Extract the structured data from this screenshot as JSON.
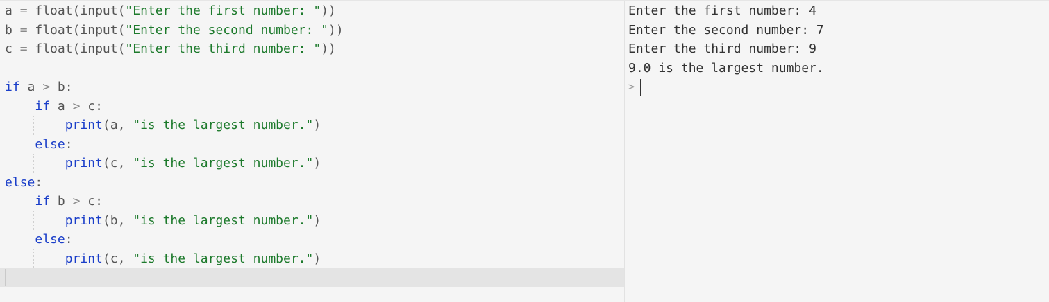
{
  "editor": {
    "lines": [
      [
        {
          "t": "a ",
          "c": "plain"
        },
        {
          "t": "=",
          "c": "op"
        },
        {
          "t": " float(input(",
          "c": "plain"
        },
        {
          "t": "\"Enter the first number: \"",
          "c": "str"
        },
        {
          "t": "))",
          "c": "plain"
        }
      ],
      [
        {
          "t": "b ",
          "c": "plain"
        },
        {
          "t": "=",
          "c": "op"
        },
        {
          "t": " float(input(",
          "c": "plain"
        },
        {
          "t": "\"Enter the second number: \"",
          "c": "str"
        },
        {
          "t": "))",
          "c": "plain"
        }
      ],
      [
        {
          "t": "c ",
          "c": "plain"
        },
        {
          "t": "=",
          "c": "op"
        },
        {
          "t": " float(input(",
          "c": "plain"
        },
        {
          "t": "\"Enter the third number: \"",
          "c": "str"
        },
        {
          "t": "))",
          "c": "plain"
        }
      ],
      [],
      [
        {
          "t": "if",
          "c": "kw"
        },
        {
          "t": " a ",
          "c": "plain"
        },
        {
          "t": ">",
          "c": "op"
        },
        {
          "t": " b:",
          "c": "plain"
        }
      ],
      [
        {
          "t": "    ",
          "c": "plain"
        },
        {
          "t": "if",
          "c": "kw"
        },
        {
          "t": " a ",
          "c": "plain"
        },
        {
          "t": ">",
          "c": "op"
        },
        {
          "t": " c:",
          "c": "plain"
        }
      ],
      [
        {
          "t": "        ",
          "c": "plain"
        },
        {
          "t": "print",
          "c": "fn"
        },
        {
          "t": "(a, ",
          "c": "plain"
        },
        {
          "t": "\"is the largest number.\"",
          "c": "str"
        },
        {
          "t": ")",
          "c": "plain"
        }
      ],
      [
        {
          "t": "    ",
          "c": "plain"
        },
        {
          "t": "else",
          "c": "kw"
        },
        {
          "t": ":",
          "c": "plain"
        }
      ],
      [
        {
          "t": "        ",
          "c": "plain"
        },
        {
          "t": "print",
          "c": "fn"
        },
        {
          "t": "(c, ",
          "c": "plain"
        },
        {
          "t": "\"is the largest number.\"",
          "c": "str"
        },
        {
          "t": ")",
          "c": "plain"
        }
      ],
      [
        {
          "t": "else",
          "c": "kw"
        },
        {
          "t": ":",
          "c": "plain"
        }
      ],
      [
        {
          "t": "    ",
          "c": "plain"
        },
        {
          "t": "if",
          "c": "kw"
        },
        {
          "t": " b ",
          "c": "plain"
        },
        {
          "t": ">",
          "c": "op"
        },
        {
          "t": " c:",
          "c": "plain"
        }
      ],
      [
        {
          "t": "        ",
          "c": "plain"
        },
        {
          "t": "print",
          "c": "fn"
        },
        {
          "t": "(b, ",
          "c": "plain"
        },
        {
          "t": "\"is the largest number.\"",
          "c": "str"
        },
        {
          "t": ")",
          "c": "plain"
        }
      ],
      [
        {
          "t": "    ",
          "c": "plain"
        },
        {
          "t": "else",
          "c": "kw"
        },
        {
          "t": ":",
          "c": "plain"
        }
      ],
      [
        {
          "t": "        ",
          "c": "plain"
        },
        {
          "t": "print",
          "c": "fn"
        },
        {
          "t": "(c, ",
          "c": "plain"
        },
        {
          "t": "\"is the largest number.\"",
          "c": "str"
        },
        {
          "t": ")",
          "c": "plain"
        }
      ]
    ],
    "indent_guide_lines": [
      6,
      8,
      11,
      13
    ]
  },
  "console": {
    "lines": [
      "Enter the first number: 4",
      "Enter the second number: 7",
      "Enter the third number: 9",
      "9.0 is the largest number."
    ],
    "prompt": ">"
  },
  "colors": {
    "keyword": "#1a3ec9",
    "string": "#1d7a2c",
    "operator": "#8a8a8a",
    "text": "#555555",
    "background": "#f5f5f5"
  }
}
